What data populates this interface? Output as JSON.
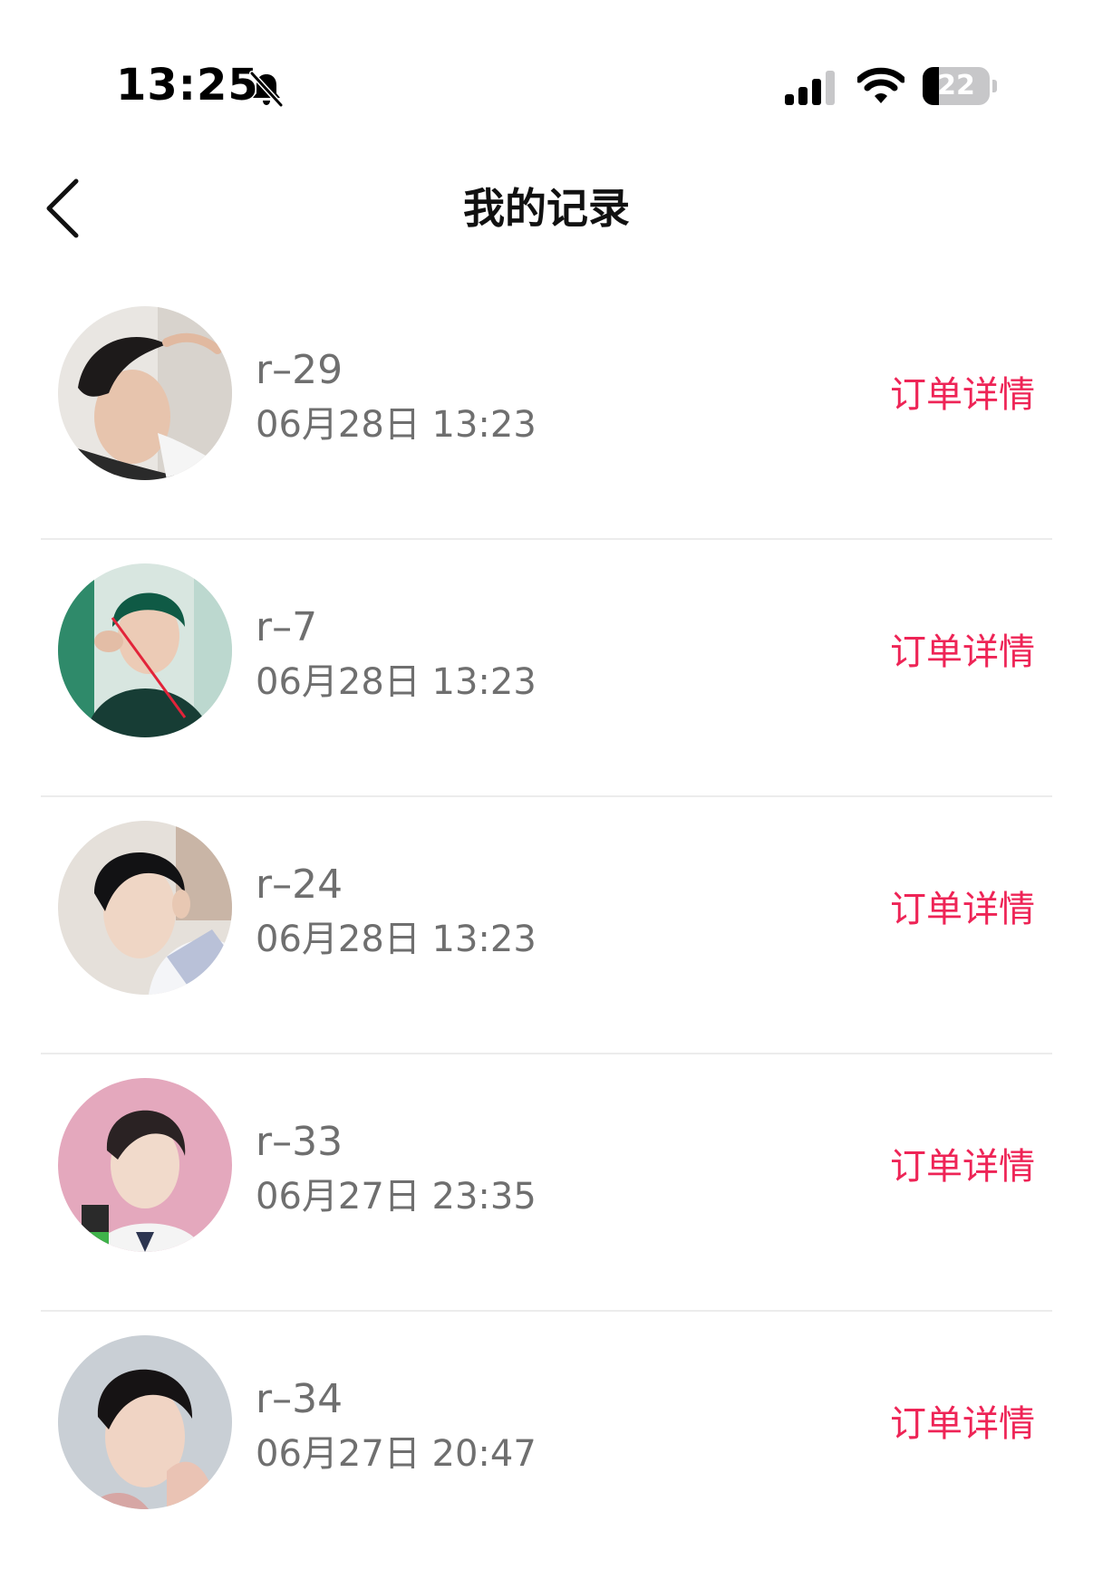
{
  "status_bar": {
    "time": "13:25",
    "battery_level": "22",
    "icons": [
      "bell-slash-icon",
      "cellular-signal-icon",
      "wifi-icon",
      "battery-icon"
    ]
  },
  "header": {
    "title": "我的记录",
    "back_icon": "chevron-left-icon"
  },
  "colors": {
    "accent": "#ee2456",
    "secondary_text": "#6f6f6f",
    "divider": "#ececec"
  },
  "records": [
    {
      "name": "r–29",
      "time": "06月28日 13:23",
      "action": "订单详情"
    },
    {
      "name": "r–7",
      "time": "06月28日 13:23",
      "action": "订单详情"
    },
    {
      "name": "r–24",
      "time": "06月28日 13:23",
      "action": "订单详情"
    },
    {
      "name": "r–33",
      "time": "06月27日 23:35",
      "action": "订单详情"
    },
    {
      "name": "r–34",
      "time": "06月27日 20:47",
      "action": "订单详情"
    }
  ]
}
